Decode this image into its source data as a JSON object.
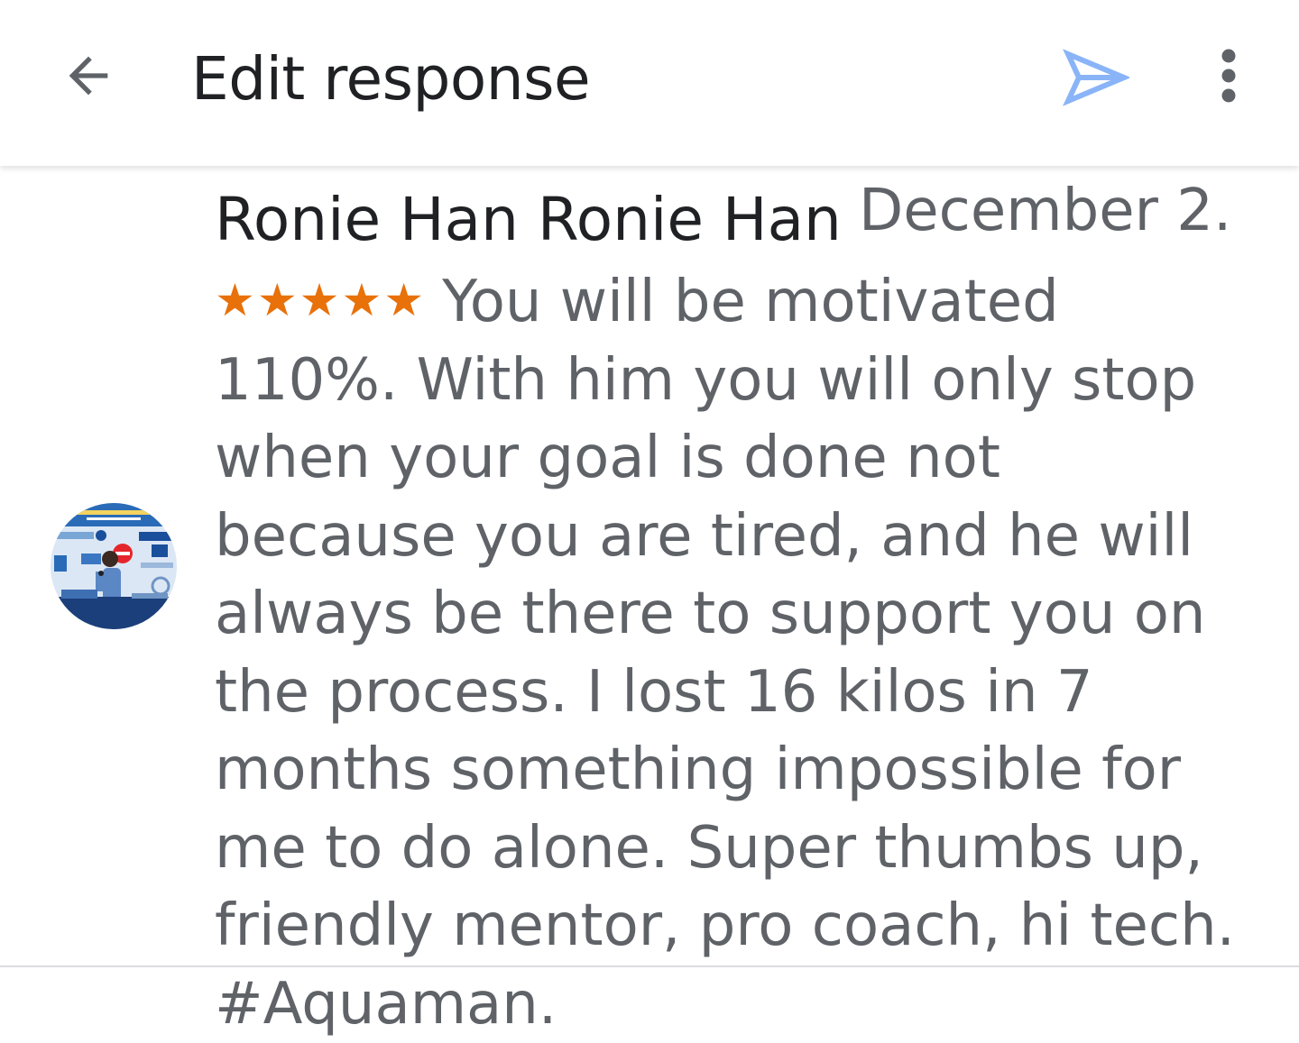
{
  "app_bar": {
    "title": "Edit response",
    "back_icon": "arrow-back-icon",
    "send_icon": "send-icon",
    "more_icon": "more-vert-icon",
    "send_color": "#8ab4f8"
  },
  "review": {
    "reviewer_name": "Ronie Han Ronie Han",
    "date": "December 2...",
    "stars": "★★★★★",
    "rating": 5,
    "star_color": "#e8710a",
    "text": "You will be motivated 110%. With him you will only stop when your goal is done not because you are tired, and he will always be there to support you on the process. I lost 16 kilos in 7 months something impossible for me to do alone. Super thumbs up, friendly mentor, pro coach, hi tech. #Aquaman."
  }
}
